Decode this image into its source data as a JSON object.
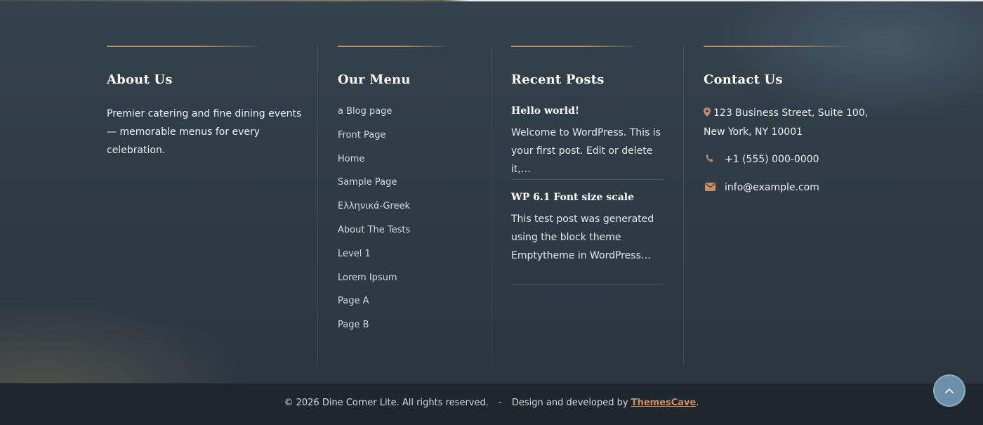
{
  "about": {
    "heading": "About Us",
    "text": "Premier catering and fine dining events — memorable menus for every celebration."
  },
  "menu": {
    "heading": "Our Menu",
    "items": [
      "a Blog page",
      "Front Page",
      "Home",
      "Sample Page",
      "Ελληνικά-Greek",
      "About The Tests",
      "Level 1",
      "Lorem Ipsum",
      "Page A",
      "Page B"
    ]
  },
  "recent_posts": {
    "heading": "Recent Posts",
    "posts": [
      {
        "title": "Hello world!",
        "excerpt": "Welcome to WordPress. This is your first post. Edit or delete it,…"
      },
      {
        "title": "WP 6.1 Font size scale",
        "excerpt": "This test post was generated using the block theme Emptytheme in WordPress…"
      }
    ]
  },
  "contact": {
    "heading": "Contact Us",
    "address": "123 Business Street, Suite 100, New York, NY 10001",
    "phone": "+1 (555) 000-0000",
    "email": "info@example.com"
  },
  "footer": {
    "copyright": "© 2026 Dine Corner Lite. All rights reserved.",
    "separator": "-",
    "credit_prefix": "Design and developed by",
    "credit_link": "ThemesCave",
    "credit_suffix": "."
  },
  "icons": {
    "address": "map-marker-icon",
    "phone": "phone-icon",
    "email": "envelope-icon",
    "scroll_top": "chevron-up-icon"
  },
  "colors": {
    "accent": "#c8906a",
    "background": "#2c3a45",
    "bottom_bar": "#1f272e",
    "scroll_button": "#6a8fa8"
  }
}
